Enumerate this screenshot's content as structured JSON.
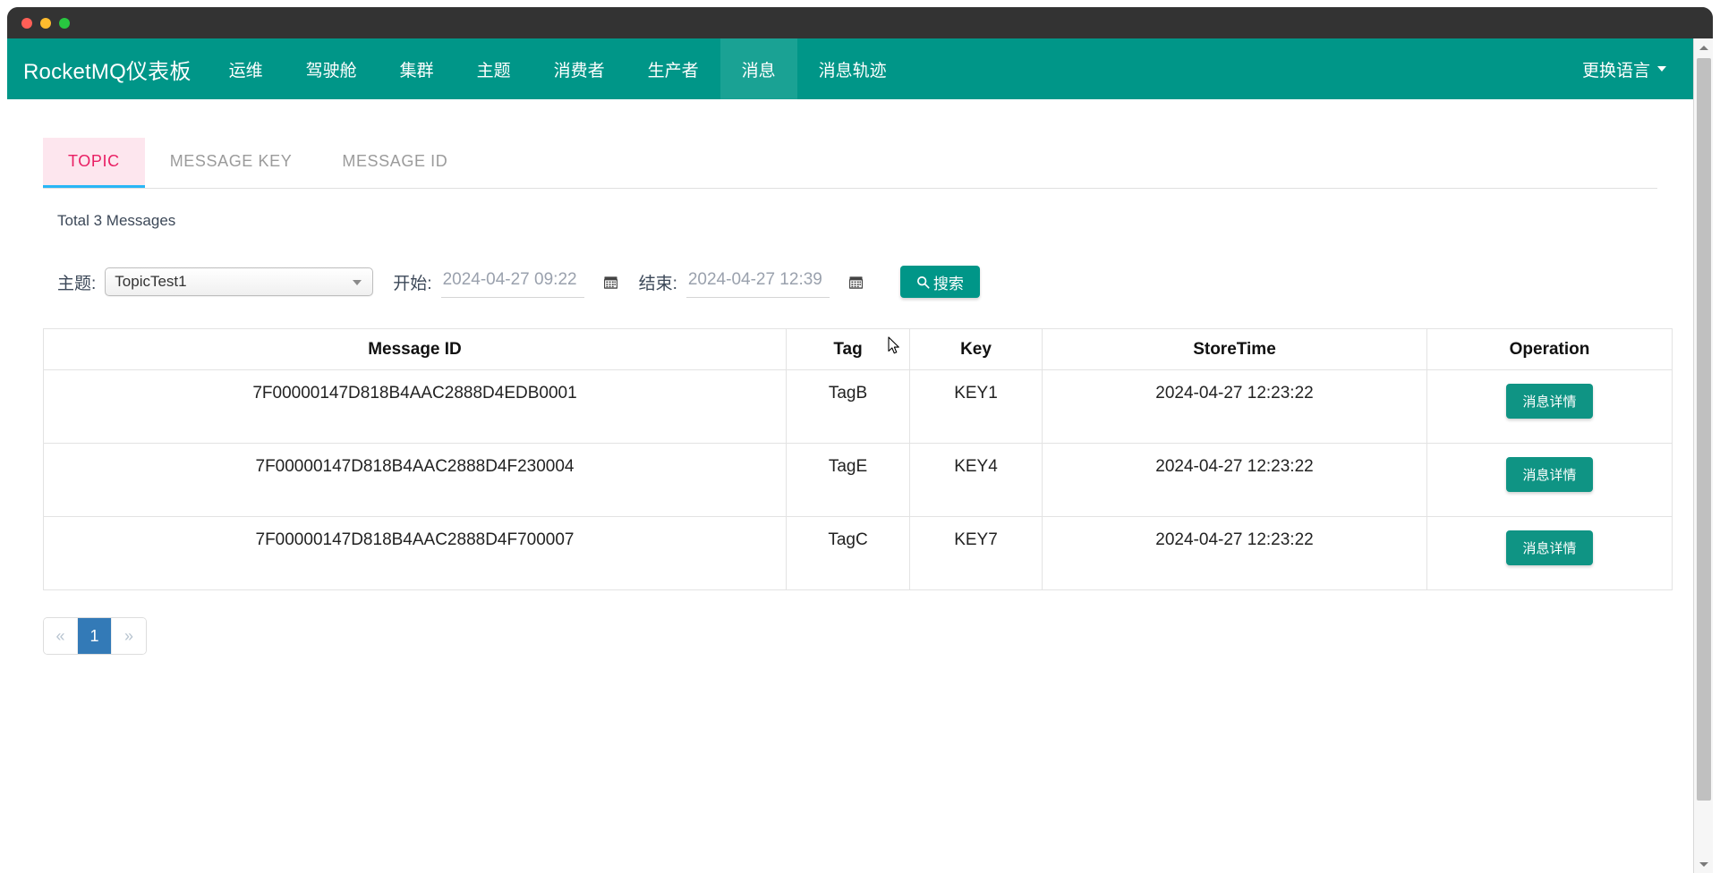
{
  "window": {
    "controls": [
      "close",
      "minimize",
      "maximize"
    ]
  },
  "navbar": {
    "brand": "RocketMQ仪表板",
    "items": [
      {
        "label": "运维",
        "active": false
      },
      {
        "label": "驾驶舱",
        "active": false
      },
      {
        "label": "集群",
        "active": false
      },
      {
        "label": "主题",
        "active": false
      },
      {
        "label": "消费者",
        "active": false
      },
      {
        "label": "生产者",
        "active": false
      },
      {
        "label": "消息",
        "active": true
      },
      {
        "label": "消息轨迹",
        "active": false
      }
    ],
    "language_label": "更换语言",
    "bg_color": "#009688",
    "active_bg_color": "#1aa294"
  },
  "tabs": [
    {
      "label": "TOPIC",
      "active": true
    },
    {
      "label": "MESSAGE KEY",
      "active": false
    },
    {
      "label": "MESSAGE ID",
      "active": false
    }
  ],
  "tab_active_color": "#e91e63",
  "tab_active_bg": "#fde6ee",
  "tab_underline_color": "#29b6f6",
  "summary": {
    "total_text": "Total 3 Messages"
  },
  "search": {
    "topic_label": "主题:",
    "topic_value": "TopicTest1",
    "begin_label": "开始:",
    "begin_placeholder": "2024-04-27 09:22",
    "begin_value": "",
    "end_label": "结束:",
    "end_placeholder": "2024-04-27 12:39",
    "end_value": "",
    "search_button": "搜索",
    "search_icon": "search-icon",
    "calendar_icon": "calendar-icon",
    "button_color": "#009688"
  },
  "table": {
    "columns": [
      "Message ID",
      "Tag",
      "Key",
      "StoreTime",
      "Operation"
    ],
    "rows": [
      {
        "message_id": "7F00000147D818B4AAC2888D4EDB0001",
        "tag": "TagB",
        "key": "KEY1",
        "store_time": "2024-04-27 12:23:22",
        "operation": "消息详情"
      },
      {
        "message_id": "7F00000147D818B4AAC2888D4F230004",
        "tag": "TagE",
        "key": "KEY4",
        "store_time": "2024-04-27 12:23:22",
        "operation": "消息详情"
      },
      {
        "message_id": "7F00000147D818B4AAC2888D4F700007",
        "tag": "TagC",
        "key": "KEY7",
        "store_time": "2024-04-27 12:23:22",
        "operation": "消息详情"
      }
    ],
    "detail_button_color": "#0f9484"
  },
  "pagination": {
    "prev": "«",
    "next": "»",
    "pages": [
      "1"
    ],
    "current_page": "1",
    "active_color": "#337ab7"
  }
}
